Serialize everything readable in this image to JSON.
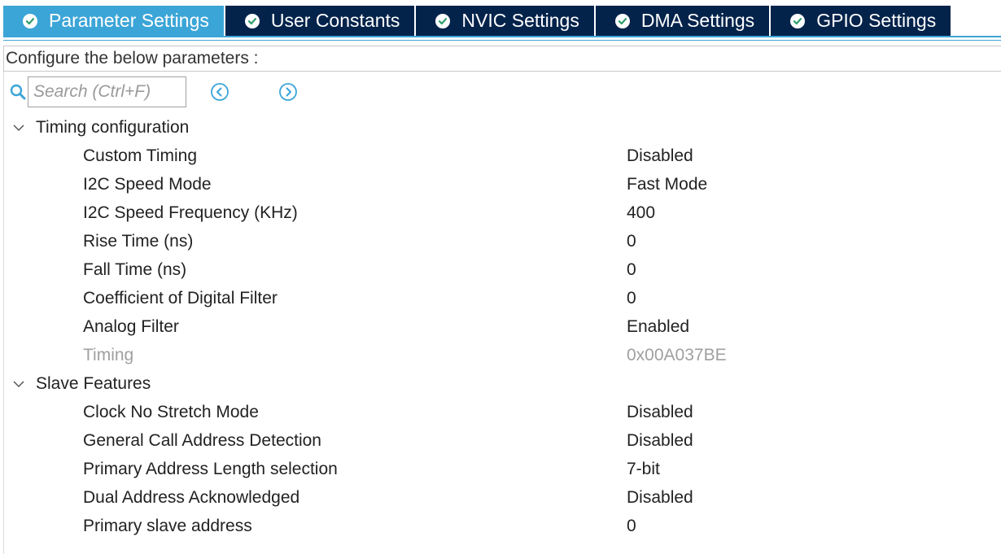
{
  "tabs": [
    {
      "label": "Parameter Settings",
      "active": true
    },
    {
      "label": "User Constants",
      "active": false
    },
    {
      "label": "NVIC Settings",
      "active": false
    },
    {
      "label": "DMA Settings",
      "active": false
    },
    {
      "label": "GPIO Settings",
      "active": false
    }
  ],
  "header": {
    "configure_label": "Configure the below parameters :"
  },
  "search": {
    "placeholder": "Search (Ctrl+F)",
    "value": ""
  },
  "colors": {
    "tab_active": "#3ca5d7",
    "tab_inactive": "#03234b",
    "check_fill": "#2e9e6b",
    "nav_icon": "#3ca5d7"
  },
  "groups": {
    "timing": {
      "title": "Timing configuration",
      "params": [
        {
          "label": "Custom Timing",
          "value": "Disabled"
        },
        {
          "label": "I2C Speed Mode",
          "value": "Fast Mode"
        },
        {
          "label": "I2C Speed Frequency (KHz)",
          "value": "400"
        },
        {
          "label": "Rise Time (ns)",
          "value": "0"
        },
        {
          "label": "Fall Time (ns)",
          "value": "0"
        },
        {
          "label": "Coefficient of Digital Filter",
          "value": "0"
        },
        {
          "label": "Analog Filter",
          "value": "Enabled"
        },
        {
          "label": "Timing",
          "value": "0x00A037BE"
        }
      ]
    },
    "slave": {
      "title": "Slave Features",
      "params": [
        {
          "label": "Clock No Stretch Mode",
          "value": "Disabled"
        },
        {
          "label": "General Call Address Detection",
          "value": "Disabled"
        },
        {
          "label": "Primary Address Length selection",
          "value": "7-bit"
        },
        {
          "label": "Dual Address Acknowledged",
          "value": "Disabled"
        },
        {
          "label": "Primary slave address",
          "value": "0"
        }
      ]
    }
  }
}
